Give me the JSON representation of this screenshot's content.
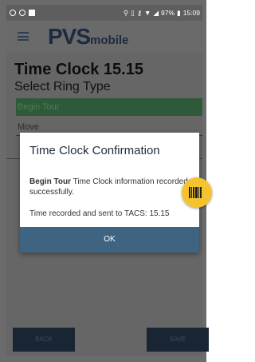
{
  "status_bar": {
    "battery": "97%",
    "time": "15:09"
  },
  "app": {
    "logo_main": "PVS",
    "logo_sub": "mobile"
  },
  "page": {
    "title": "Time Clock 15.15",
    "subtitle": "Select Ring Type",
    "ring_types": [
      "Begin Tour",
      "Move"
    ]
  },
  "bottom_buttons": {
    "back": "BACK",
    "save": "SAVE"
  },
  "dialog": {
    "title": "Time Clock Confirmation",
    "message_bold": "Begin Tour",
    "message_rest": " Time Clock information recorded successfully.",
    "time_recorded": "Time recorded and sent to TACS: 15.15",
    "ok_label": "OK"
  },
  "colors": {
    "dialog_button": "#3e6482",
    "fab": "#f4c430",
    "selected_row": "#2f5a3a"
  },
  "icons": {
    "fab_icon": "barcode-icon",
    "menu_icon": "menu-icon"
  }
}
